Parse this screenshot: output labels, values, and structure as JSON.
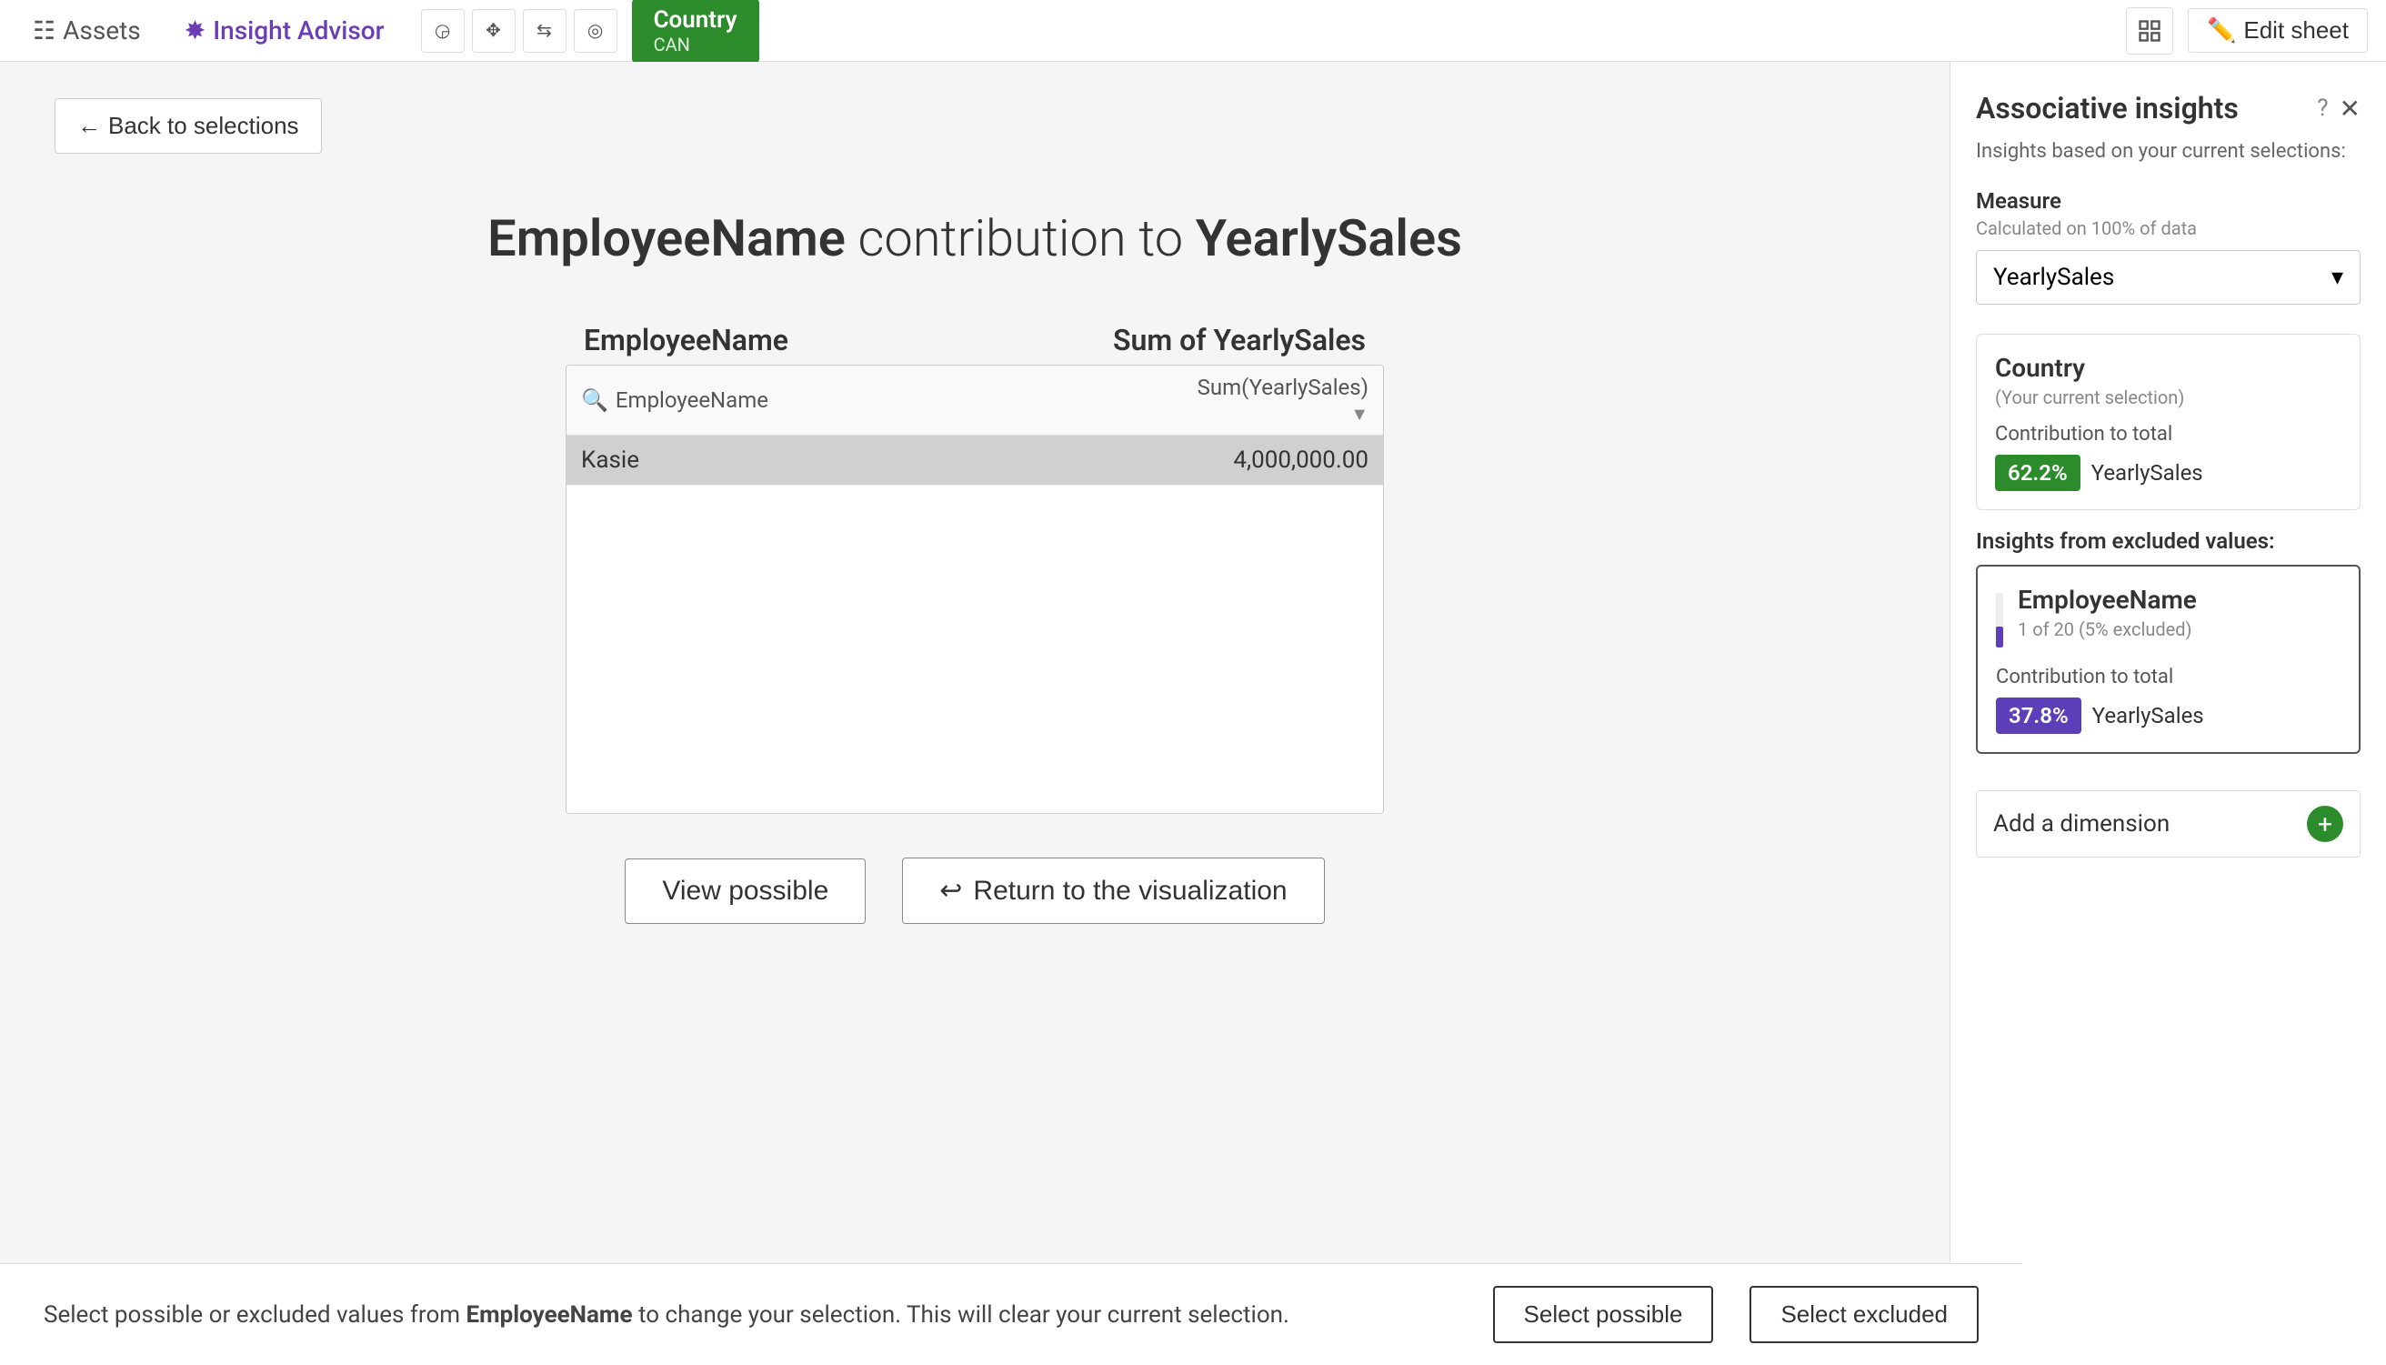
{
  "topbar": {
    "assets_label": "Assets",
    "insight_advisor_label": "Insight Advisor",
    "country_tab_name": "Country",
    "country_tab_value": "CAN",
    "edit_sheet_label": "Edit sheet"
  },
  "back_button": {
    "label": "Back to selections"
  },
  "page": {
    "title_part1": "EmployeeName",
    "title_middle": " contribution to ",
    "title_part2": "YearlySales"
  },
  "table": {
    "col_left": "EmployeeName",
    "col_right": "Sum of YearlySales",
    "search_placeholder": "EmployeeName",
    "col_header_right": "Sum(YearlySales)",
    "rows": [
      {
        "name": "Kasie",
        "value": "4,000,000.00",
        "selected": true
      }
    ]
  },
  "bottom_actions": {
    "view_possible": "View possible",
    "return_viz": "Return to the visualization"
  },
  "notification": {
    "text_before": "Select possible or excluded values from ",
    "field_name": "EmployeeName",
    "text_after": " to change your selection. This will clear your current selection.",
    "select_possible": "Select possible",
    "select_excluded": "Select excluded"
  },
  "sidebar": {
    "title": "Associative insights",
    "subtitle": "Insights based on your current selections:",
    "measure_section_label": "Measure",
    "measure_section_sub": "Calculated on 100% of data",
    "measure_value": "YearlySales",
    "current_selection_title": "Country",
    "current_selection_sub": "(Your current selection)",
    "contribution_label1": "Contribution to total",
    "badge_green": "62.2%",
    "badge_green_label": "YearlySales",
    "excluded_section_label": "Insights from excluded values:",
    "excluded_title": "EmployeeName",
    "excluded_sub": "1 of 20 (5% excluded)",
    "contribution_label2": "Contribution to total",
    "badge_purple": "37.8%",
    "badge_purple_label": "YearlySales",
    "add_dimension_label": "Add a dimension",
    "mini_bar_height_pct": 37.8
  }
}
